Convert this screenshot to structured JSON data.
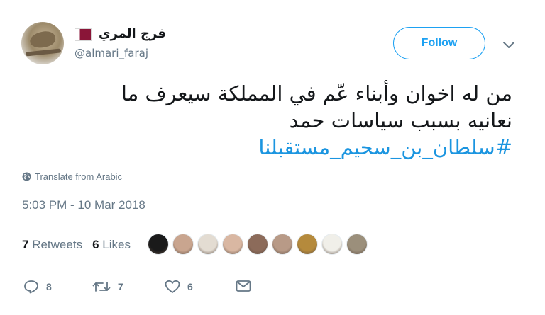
{
  "author": {
    "display_name": "فرج المري",
    "handle": "@almari_faraj",
    "flag_icon": "qatar-flag-icon"
  },
  "follow_label": "Follow",
  "tweet": {
    "line1": "من له اخوان وأبناء عّم في المملكة سيعرف ما",
    "line2": "نعانيه بسبب سياسات حمد",
    "hashtag": "#سلطان_بن_سحيم_مستقبلنا"
  },
  "translate_label": "Translate from Arabic",
  "timestamp": "5:03 PM - 10 Mar 2018",
  "stats": {
    "retweets_count": "7",
    "retweets_label": "Retweets",
    "likes_count": "6",
    "likes_label": "Likes"
  },
  "likers": [
    {
      "color": "#1a1a1a"
    },
    {
      "color": "#c9a58f"
    },
    {
      "color": "#e3dcd2"
    },
    {
      "color": "#d9b7a2"
    },
    {
      "color": "#8c6b5a"
    },
    {
      "color": "#b89a87"
    },
    {
      "color": "#b58a3c"
    },
    {
      "color": "#f0efe9"
    },
    {
      "color": "#9b8f7b"
    }
  ],
  "actions": {
    "reply_count": "8",
    "retweet_count": "7",
    "like_count": "6"
  }
}
